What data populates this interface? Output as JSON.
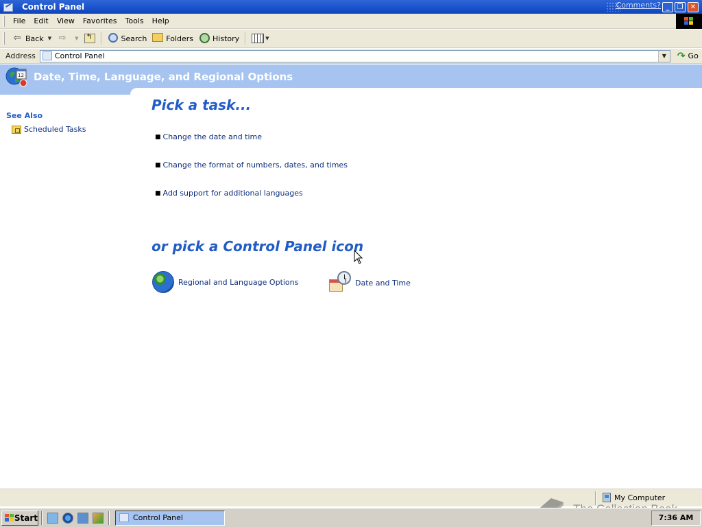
{
  "window": {
    "title": "Control Panel",
    "comments_link": "Comments?"
  },
  "menubar": {
    "items": [
      "File",
      "Edit",
      "View",
      "Favorites",
      "Tools",
      "Help"
    ]
  },
  "toolbar": {
    "back_label": "Back",
    "search_label": "Search",
    "folders_label": "Folders",
    "history_label": "History"
  },
  "address": {
    "label": "Address",
    "value": "Control Panel",
    "go_label": "Go"
  },
  "banner": {
    "title": "Date, Time, Language, and Regional Options"
  },
  "see_also": {
    "title": "See Also",
    "items": [
      {
        "label": "Scheduled Tasks",
        "icon": "scheduled-tasks-folder-icon"
      }
    ]
  },
  "main": {
    "pick_task_heading": "Pick a task...",
    "tasks": [
      "Change the date and time",
      "Change the format of numbers, dates, and times",
      "Add support for additional languages"
    ],
    "pick_icon_heading": "or pick a Control Panel icon",
    "icons": [
      {
        "label": "Regional and Language Options",
        "icon": "globe-icon"
      },
      {
        "label": "Date and Time",
        "icon": "date-time-icon"
      }
    ]
  },
  "statusbar": {
    "zone": "My Computer"
  },
  "watermark": {
    "text": "The Collection Book"
  },
  "taskbar": {
    "start_label": "Start",
    "window_button": "Control Panel",
    "clock": "7:36 AM"
  },
  "colors": {
    "title_bar": "#0e45bd",
    "banner": "#a6c4ef",
    "heading_blue": "#215dc6",
    "link": "#0c2d7a"
  }
}
